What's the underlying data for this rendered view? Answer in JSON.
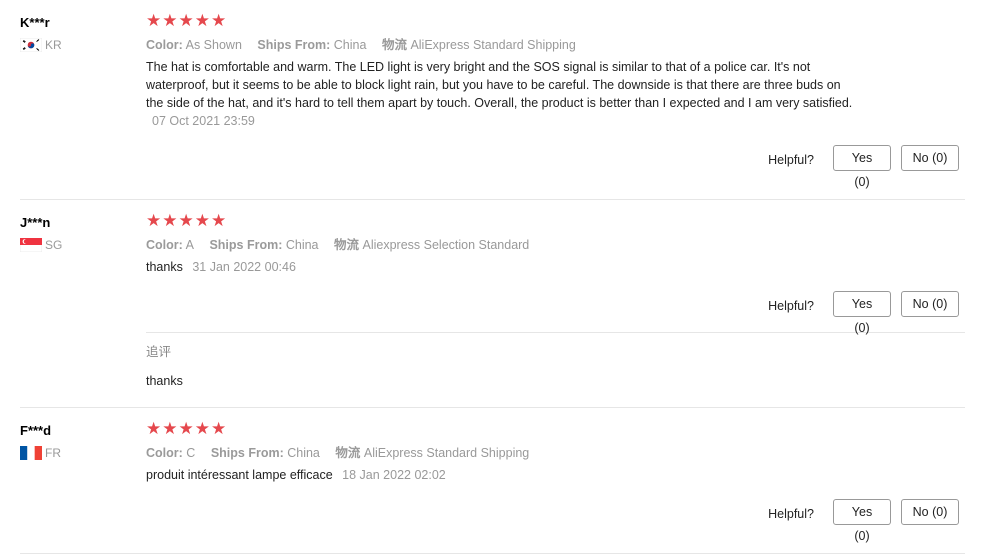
{
  "reviews": [
    {
      "user": "K***r",
      "country": "KR",
      "stars": 5,
      "color_label": "Color:",
      "color_value": "As Shown",
      "ships_label": "Ships From:",
      "ships_value": "China",
      "logistics_label": "物流",
      "logistics_value": "AliExpress Standard Shipping",
      "text": "The hat is comfortable and warm. The LED light is very bright and the SOS signal is similar to that of a police car. It's not waterproof, but it seems to be able to block light rain, but you have to be careful. The downside is that there are three buds on the side of the hat, and it's hard to tell them apart by touch. Overall, the product is better than I expected and I am very satisfied.",
      "date": "07 Oct 2021 23:59",
      "helpful_label": "Helpful?",
      "yes_label": "Yes (0)",
      "no_label": "No (0)"
    },
    {
      "user": "J***n",
      "country": "SG",
      "stars": 5,
      "color_label": "Color:",
      "color_value": "A",
      "ships_label": "Ships From:",
      "ships_value": "China",
      "logistics_label": "物流",
      "logistics_value": "Aliexpress Selection Standard",
      "text": "thanks",
      "date": "31 Jan 2022 00:46",
      "helpful_label": "Helpful?",
      "yes_label": "Yes (0)",
      "no_label": "No (0)",
      "followup_title": "追评",
      "followup_text": "thanks"
    },
    {
      "user": "F***d",
      "country": "FR",
      "stars": 5,
      "color_label": "Color:",
      "color_value": "C",
      "ships_label": "Ships From:",
      "ships_value": "China",
      "logistics_label": "物流",
      "logistics_value": "AliExpress Standard Shipping",
      "text": "produit intéressant lampe efficace",
      "date": "18 Jan 2022 02:02",
      "helpful_label": "Helpful?",
      "yes_label": "Yes (0)",
      "no_label": "No (0)"
    }
  ],
  "colors": {
    "star": "#e5484d",
    "muted_text": "#999999",
    "border": "#e6e6e6"
  }
}
